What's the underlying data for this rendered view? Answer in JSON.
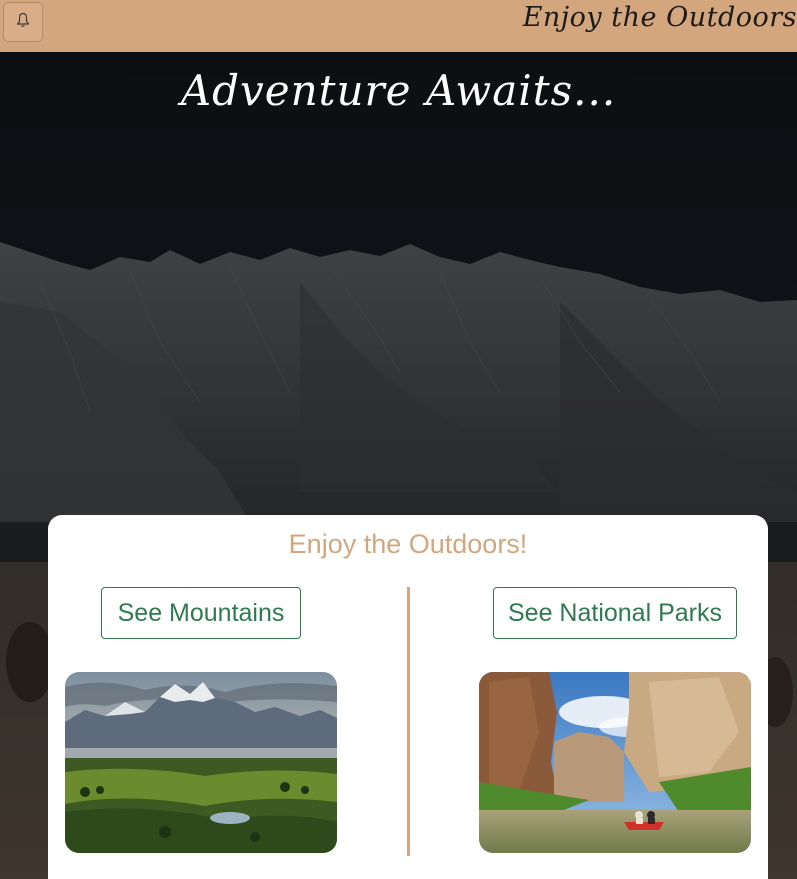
{
  "navbar": {
    "toggle_icon": "bell-icon",
    "brand": "Enjoy the Outdoors"
  },
  "hero": {
    "title": "Adventure Awaits..."
  },
  "card": {
    "title": "Enjoy the Outdoors!",
    "mountains_button": "See Mountains",
    "parks_button": "See National Parks",
    "mountains_image_icon": "mountain-landscape-image",
    "parks_image_icon": "canyon-river-image"
  },
  "colors": {
    "navbar": "#d4a67e",
    "accent_green": "#2f7a52",
    "card_title": "#d4a67e"
  }
}
